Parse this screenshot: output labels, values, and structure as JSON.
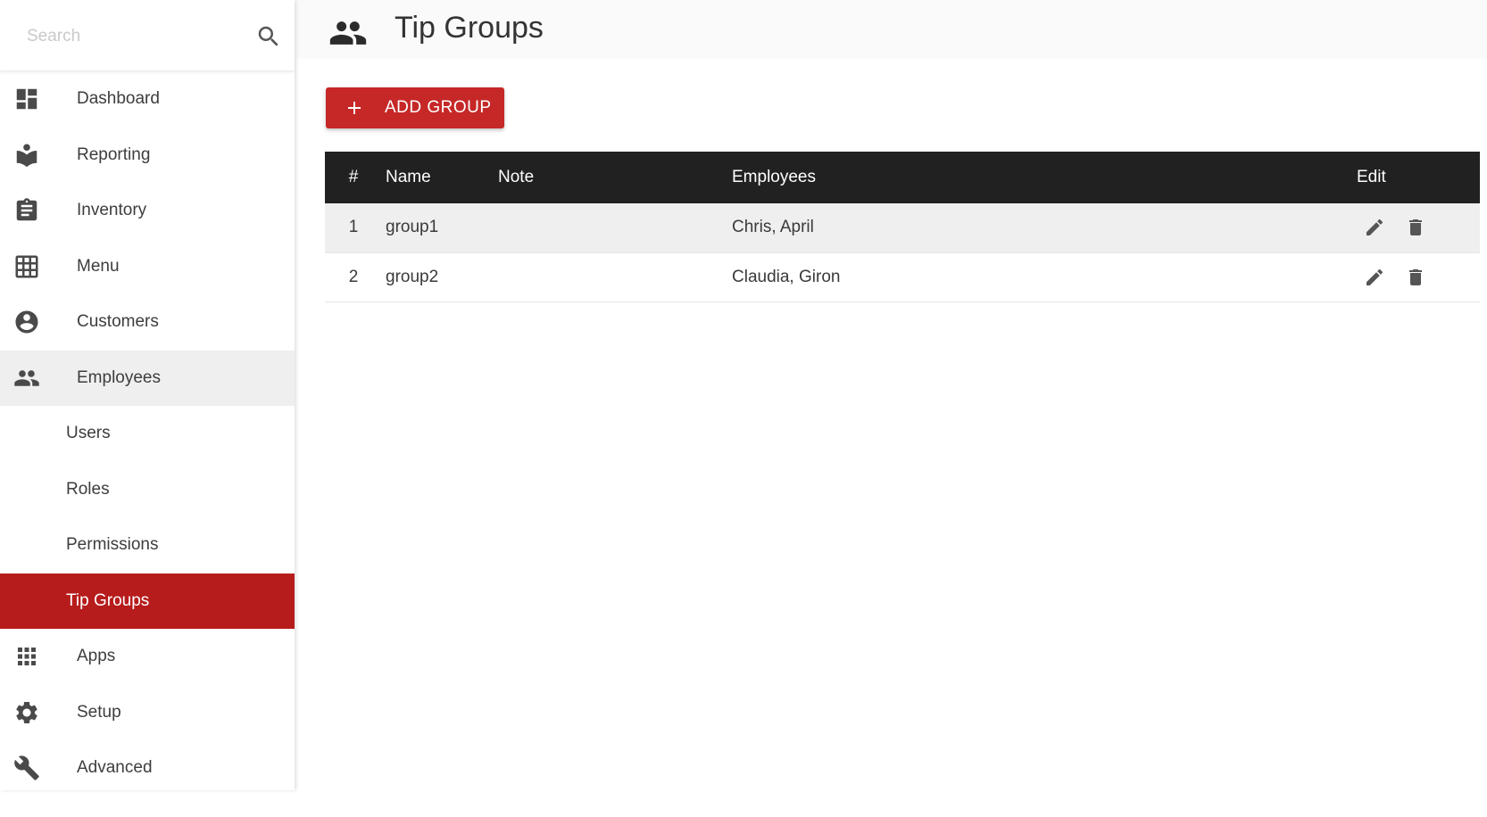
{
  "search": {
    "placeholder": "Search"
  },
  "sidebar": {
    "items": [
      {
        "label": "Dashboard"
      },
      {
        "label": "Reporting"
      },
      {
        "label": "Inventory"
      },
      {
        "label": "Menu"
      },
      {
        "label": "Customers"
      },
      {
        "label": "Employees"
      },
      {
        "label": "Users"
      },
      {
        "label": "Roles"
      },
      {
        "label": "Permissions"
      },
      {
        "label": "Tip Groups"
      },
      {
        "label": "Apps"
      },
      {
        "label": "Setup"
      },
      {
        "label": "Advanced"
      }
    ]
  },
  "header": {
    "title": "Tip Groups"
  },
  "toolbar": {
    "add_label": "ADD GROUP"
  },
  "table": {
    "columns": {
      "num": "#",
      "name": "Name",
      "note": "Note",
      "employees": "Employees",
      "edit": "Edit"
    },
    "rows": [
      {
        "num": "1",
        "name": "group1",
        "note": "",
        "employees": "Chris, April"
      },
      {
        "num": "2",
        "name": "group2",
        "note": "",
        "employees": "Claudia, Giron"
      }
    ]
  },
  "colors": {
    "accent": "#b71c1c",
    "button": "#c62828",
    "table_header": "#212121"
  }
}
